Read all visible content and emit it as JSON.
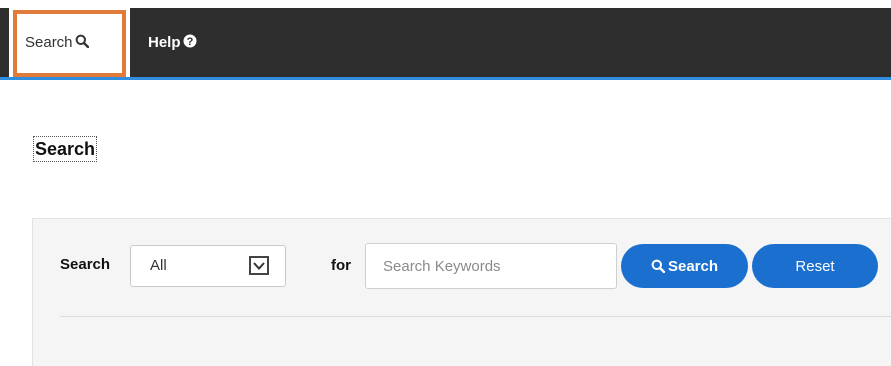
{
  "navbar": {
    "items": [
      {
        "label": "Search",
        "icon": "search-icon",
        "active": true
      },
      {
        "label": "Help",
        "icon": "question-circle-icon",
        "active": false
      }
    ],
    "accent_color": "#2f8ee0",
    "highlight_color": "#e07b3a"
  },
  "page": {
    "title": "Search"
  },
  "search_form": {
    "scope_label": "Search",
    "scope_selected": "All",
    "for_label": "for",
    "keywords_placeholder": "Search Keywords",
    "keywords_value": "",
    "search_button_label": "Search",
    "search_button_icon": "search-icon",
    "reset_button_label": "Reset",
    "button_color": "#1a6fcf"
  }
}
